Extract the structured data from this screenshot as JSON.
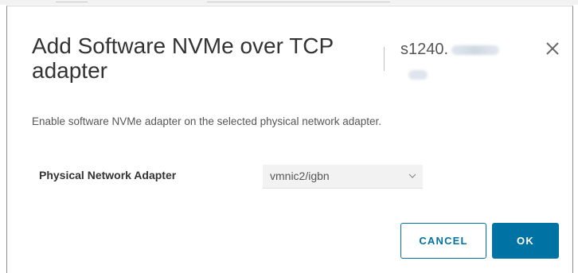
{
  "dialog": {
    "title": "Add Software NVMe over TCP adapter",
    "host_name": "s1240.",
    "description": "Enable software NVMe adapter on the selected physical network adapter.",
    "close_icon": "close-icon"
  },
  "form": {
    "adapter_label": "Physical Network Adapter",
    "adapter_value": "vmnic2/igbn",
    "chevron_icon": "chevron-down-icon"
  },
  "buttons": {
    "cancel_label": "CANCEL",
    "ok_label": "OK"
  },
  "colors": {
    "primary": "#0072a3",
    "text": "#333333",
    "muted_text": "#565656",
    "select_bg": "#f2f2f2"
  }
}
